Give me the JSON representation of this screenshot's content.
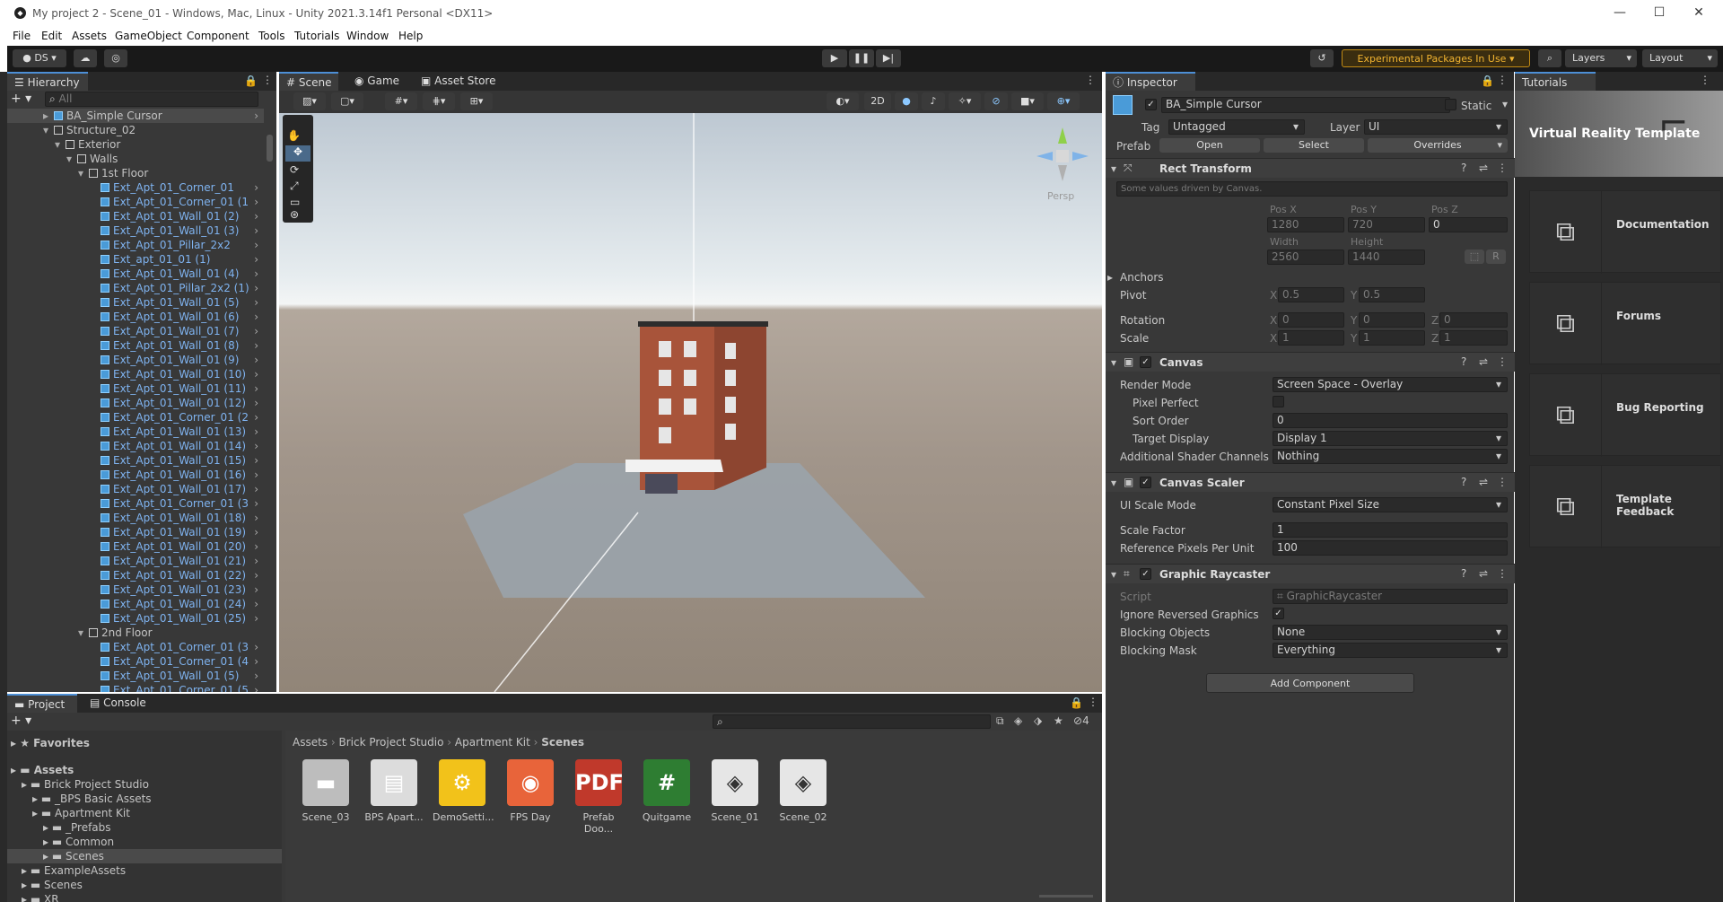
{
  "window": {
    "title": "My project 2 - Scene_01 - Windows, Mac, Linux - Unity 2021.3.14f1 Personal <DX11>"
  },
  "menu": [
    "File",
    "Edit",
    "Assets",
    "GameObject",
    "Component",
    "Tools",
    "Tutorials",
    "Window",
    "Help"
  ],
  "toolbar": {
    "account": "DS",
    "experimental": "Experimental Packages In Use",
    "layers": "Layers",
    "layout": "Layout"
  },
  "hierarchy": {
    "tab": "Hierarchy",
    "search_placeholder": "All",
    "items": [
      {
        "label": "BA_Simple Cursor",
        "indent": 0,
        "blue": false,
        "selected": true,
        "prefab": true
      },
      {
        "label": "Structure_02",
        "indent": 0,
        "blue": false,
        "expanded": true
      },
      {
        "label": "Exterior",
        "indent": 1,
        "blue": false,
        "expanded": true
      },
      {
        "label": "Walls",
        "indent": 2,
        "blue": false,
        "expanded": true
      },
      {
        "label": "1st Floor",
        "indent": 3,
        "blue": false,
        "expanded": true
      },
      {
        "label": "Ext_Apt_01_Corner_01",
        "indent": 4,
        "blue": true
      },
      {
        "label": "Ext_Apt_01_Corner_01 (1",
        "indent": 4,
        "blue": true
      },
      {
        "label": "Ext_Apt_01_Wall_01 (2)",
        "indent": 4,
        "blue": true
      },
      {
        "label": "Ext_Apt_01_Wall_01 (3)",
        "indent": 4,
        "blue": true
      },
      {
        "label": "Ext_Apt_01_Pillar_2x2",
        "indent": 4,
        "blue": true
      },
      {
        "label": "Ext_apt_01_01 (1)",
        "indent": 4,
        "blue": true
      },
      {
        "label": "Ext_Apt_01_Wall_01 (4)",
        "indent": 4,
        "blue": true
      },
      {
        "label": "Ext_Apt_01_Pillar_2x2 (1)",
        "indent": 4,
        "blue": true
      },
      {
        "label": "Ext_Apt_01_Wall_01 (5)",
        "indent": 4,
        "blue": true
      },
      {
        "label": "Ext_Apt_01_Wall_01 (6)",
        "indent": 4,
        "blue": true
      },
      {
        "label": "Ext_Apt_01_Wall_01 (7)",
        "indent": 4,
        "blue": true
      },
      {
        "label": "Ext_Apt_01_Wall_01 (8)",
        "indent": 4,
        "blue": true
      },
      {
        "label": "Ext_Apt_01_Wall_01 (9)",
        "indent": 4,
        "blue": true
      },
      {
        "label": "Ext_Apt_01_Wall_01 (10)",
        "indent": 4,
        "blue": true
      },
      {
        "label": "Ext_Apt_01_Wall_01 (11)",
        "indent": 4,
        "blue": true
      },
      {
        "label": "Ext_Apt_01_Wall_01 (12)",
        "indent": 4,
        "blue": true
      },
      {
        "label": "Ext_Apt_01_Corner_01 (2",
        "indent": 4,
        "blue": true
      },
      {
        "label": "Ext_Apt_01_Wall_01 (13)",
        "indent": 4,
        "blue": true
      },
      {
        "label": "Ext_Apt_01_Wall_01 (14)",
        "indent": 4,
        "blue": true
      },
      {
        "label": "Ext_Apt_01_Wall_01 (15)",
        "indent": 4,
        "blue": true
      },
      {
        "label": "Ext_Apt_01_Wall_01 (16)",
        "indent": 4,
        "blue": true
      },
      {
        "label": "Ext_Apt_01_Wall_01 (17)",
        "indent": 4,
        "blue": true
      },
      {
        "label": "Ext_Apt_01_Corner_01 (3",
        "indent": 4,
        "blue": true
      },
      {
        "label": "Ext_Apt_01_Wall_01 (18)",
        "indent": 4,
        "blue": true
      },
      {
        "label": "Ext_Apt_01_Wall_01 (19)",
        "indent": 4,
        "blue": true
      },
      {
        "label": "Ext_Apt_01_Wall_01 (20)",
        "indent": 4,
        "blue": true
      },
      {
        "label": "Ext_Apt_01_Wall_01 (21)",
        "indent": 4,
        "blue": true
      },
      {
        "label": "Ext_Apt_01_Wall_01 (22)",
        "indent": 4,
        "blue": true
      },
      {
        "label": "Ext_Apt_01_Wall_01 (23)",
        "indent": 4,
        "blue": true
      },
      {
        "label": "Ext_Apt_01_Wall_01 (24)",
        "indent": 4,
        "blue": true
      },
      {
        "label": "Ext_Apt_01_Wall_01 (25)",
        "indent": 4,
        "blue": true
      },
      {
        "label": "2nd Floor",
        "indent": 3,
        "blue": false,
        "expanded": true
      },
      {
        "label": "Ext_Apt_01_Corner_01 (3",
        "indent": 4,
        "blue": true
      },
      {
        "label": "Ext_Apt_01_Corner_01 (4",
        "indent": 4,
        "blue": true
      },
      {
        "label": "Ext_Apt_01_Wall_01 (5)",
        "indent": 4,
        "blue": true
      },
      {
        "label": "Ext_Apt_01_Corner_01 (5",
        "indent": 4,
        "blue": true
      }
    ]
  },
  "scene": {
    "tabs": [
      "Scene",
      "Game",
      "Asset Store"
    ],
    "mode_2d": "2D",
    "gizmo_label": "Persp"
  },
  "inspector": {
    "tab": "Inspector",
    "object_name": "BA_Simple Cursor",
    "static_label": "Static",
    "tag_label": "Tag",
    "tag_value": "Untagged",
    "layer_label": "Layer",
    "layer_value": "UI",
    "prefab_label": "Prefab",
    "prefab_open": "Open",
    "prefab_select": "Select",
    "prefab_overrides": "Overrides",
    "rect": {
      "title": "Rect Transform",
      "note": "Some values driven by Canvas.",
      "pos_x_label": "Pos X",
      "pos_y_label": "Pos Y",
      "pos_z_label": "Pos Z",
      "pos_x": "1280",
      "pos_y": "720",
      "pos_z": "0",
      "width_label": "Width",
      "height_label": "Height",
      "width": "2560",
      "height": "1440",
      "r_label": "R",
      "anchors": "Anchors",
      "pivot_label": "Pivot",
      "pivot_x": "0.5",
      "pivot_y": "0.5",
      "rotation_label": "Rotation",
      "rot_x": "0",
      "rot_y": "0",
      "rot_z": "0",
      "scale_label": "Scale",
      "scale_x": "1",
      "scale_y": "1",
      "scale_z": "1"
    },
    "canvas": {
      "title": "Canvas",
      "render_mode_label": "Render Mode",
      "render_mode": "Screen Space - Overlay",
      "pixel_perfect_label": "Pixel Perfect",
      "sort_order_label": "Sort Order",
      "sort_order": "0",
      "target_display_label": "Target Display",
      "target_display": "Display 1",
      "shader_channels_label": "Additional Shader Channels",
      "shader_channels": "Nothing"
    },
    "scaler": {
      "title": "Canvas Scaler",
      "mode_label": "UI Scale Mode",
      "mode": "Constant Pixel Size",
      "factor_label": "Scale Factor",
      "factor": "1",
      "ppu_label": "Reference Pixels Per Unit",
      "ppu": "100"
    },
    "raycaster": {
      "title": "Graphic Raycaster",
      "script_label": "Script",
      "script": "GraphicRaycaster",
      "ignore_label": "Ignore Reversed Graphics",
      "blocking_objects_label": "Blocking Objects",
      "blocking_objects": "None",
      "blocking_mask_label": "Blocking Mask",
      "blocking_mask": "Everything"
    },
    "add_component": "Add Component"
  },
  "tutorials": {
    "tab": "Tutorials",
    "banner": "Virtual Reality Template",
    "cards": [
      "Documentation",
      "Forums",
      "Bug Reporting",
      "Template Feedback"
    ]
  },
  "project": {
    "tabs": [
      "Project",
      "Console"
    ],
    "favorites": "Favorites",
    "tree": [
      {
        "label": "Assets",
        "indent": 0,
        "bold": true
      },
      {
        "label": "Brick Project Studio",
        "indent": 1
      },
      {
        "label": "_BPS Basic Assets",
        "indent": 2
      },
      {
        "label": "Apartment Kit",
        "indent": 2
      },
      {
        "label": "_Prefabs",
        "indent": 3
      },
      {
        "label": "Common",
        "indent": 3
      },
      {
        "label": "Scenes",
        "indent": 3,
        "selected": true
      },
      {
        "label": "ExampleAssets",
        "indent": 1
      },
      {
        "label": "Scenes",
        "indent": 1
      },
      {
        "label": "XR",
        "indent": 1
      }
    ],
    "breadcrumb": [
      "Assets",
      "Brick Project Studio",
      "Apartment Kit",
      "Scenes"
    ],
    "hidden_count": "4",
    "assets": [
      {
        "label": "Scene_03",
        "icon": "folder-icon"
      },
      {
        "label": "BPS Apart...",
        "icon": "document-icon"
      },
      {
        "label": "DemoSetti...",
        "icon": "settings-asset-icon"
      },
      {
        "label": "FPS Day",
        "icon": "lighting-icon"
      },
      {
        "label": "Prefab Doo...",
        "icon": "pdf-icon"
      },
      {
        "label": "Quitgame",
        "icon": "csharp-script-icon"
      },
      {
        "label": "Scene_01",
        "icon": "unity-scene-icon"
      },
      {
        "label": "Scene_02",
        "icon": "unity-scene-icon"
      }
    ]
  }
}
